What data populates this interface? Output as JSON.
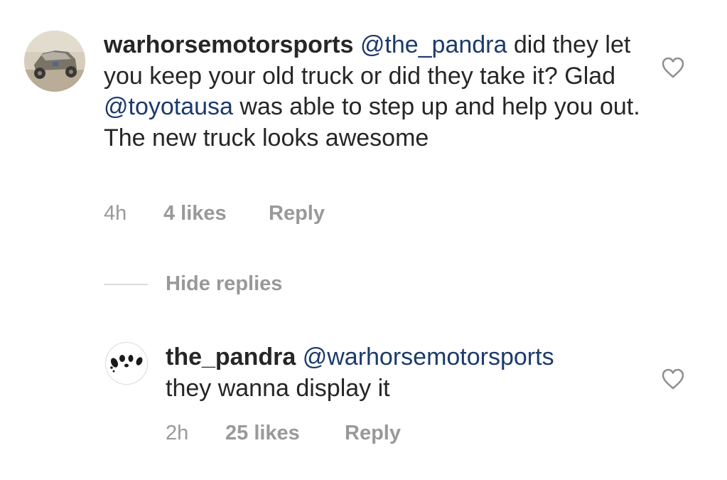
{
  "comments": [
    {
      "username": "warhorsemotorsports",
      "mention": "@the_pandra",
      "text_part1": " did they let you keep your old truck or did they take it? Glad ",
      "mention2": "@toyotausa",
      "text_part2": " was able to step up and help you out. The new truck looks awesome",
      "time": "4h",
      "likes": "4 likes",
      "reply_label": "Reply"
    }
  ],
  "thread": {
    "hide_replies_label": "Hide replies"
  },
  "replies": [
    {
      "username": "the_pandra",
      "mention": "@warhorsemotorsports",
      "text": "they wanna display it",
      "time": "2h",
      "likes": "25 likes",
      "reply_label": "Reply"
    }
  ],
  "icons": {
    "like": "heart-outline-icon"
  },
  "colors": {
    "text": "#262626",
    "mention": "#1c3a6b",
    "secondary": "#999999",
    "divider": "#dbdbdb"
  }
}
